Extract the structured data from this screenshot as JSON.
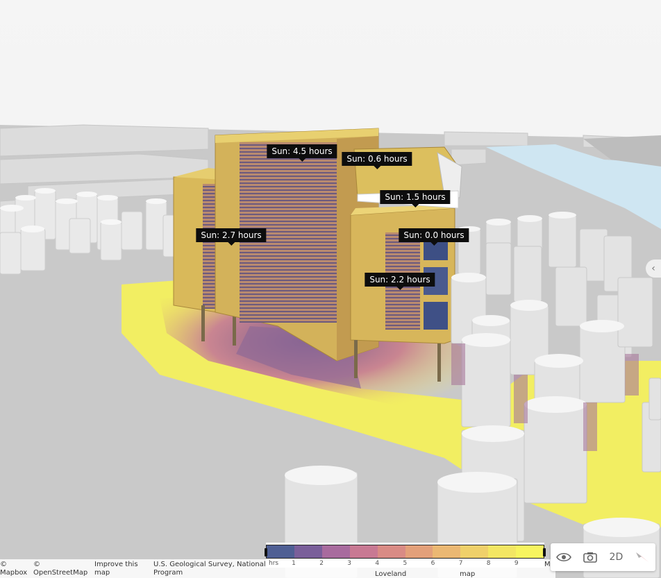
{
  "sun_labels": [
    {
      "text": "Sun: 4.5 hours"
    },
    {
      "text": "Sun: 0.6 hours"
    },
    {
      "text": "Sun: 1.5 hours"
    },
    {
      "text": "Sun: 2.7 hours"
    },
    {
      "text": "Sun: 0.0 hours"
    },
    {
      "text": "Sun: 2.2 hours"
    }
  ],
  "legend": {
    "unit": "hrs",
    "ticks": [
      "1",
      "2",
      "3",
      "4",
      "5",
      "6",
      "7",
      "8",
      "9"
    ],
    "colors": [
      "#4f5f94",
      "#7a5f9a",
      "#a86b9e",
      "#c87993",
      "#d98b85",
      "#e3a07a",
      "#ebb873",
      "#efd06a",
      "#f3e663",
      "#f7f45f"
    ]
  },
  "attribution": {
    "mapbox": "©\nMapbox",
    "osm": "©\nOpenStreetMap",
    "improve": "Improve this\nmap",
    "usgs": "U.S. Geological Survey, National Ge\nProgram",
    "loveland": "Loveland",
    "map2": "map",
    "ma": "Ma"
  },
  "controls": {
    "visibility_icon": "eye-icon",
    "camera_icon": "camera-icon",
    "toggle_2d_label": "2D",
    "compass_icon": "compass-icon"
  },
  "colors": {
    "building": "#d9b95a",
    "ground_sun": "#f2ee62",
    "river": "#cfe6f2",
    "trees": "#e3e3e3"
  }
}
